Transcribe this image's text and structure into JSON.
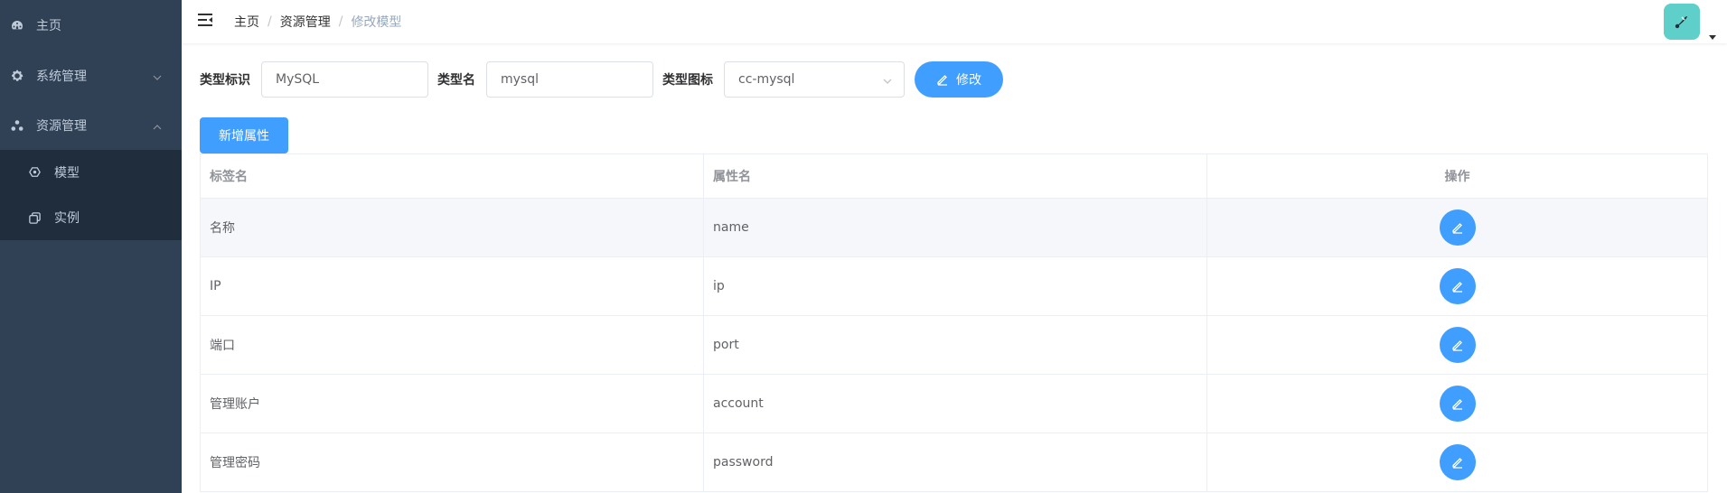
{
  "sidebar": {
    "items": [
      {
        "label": "主页",
        "icon": "dashboard-icon"
      },
      {
        "label": "系统管理",
        "icon": "gear-icon"
      },
      {
        "label": "资源管理",
        "icon": "cluster-icon"
      }
    ],
    "sub_items": [
      {
        "label": "模型",
        "icon": "model-icon"
      },
      {
        "label": "实例",
        "icon": "copy-icon"
      }
    ]
  },
  "breadcrumb": [
    "主页",
    "资源管理",
    "修改模型"
  ],
  "form": {
    "type_id_label": "类型标识",
    "type_id_value": "MySQL",
    "type_name_label": "类型名",
    "type_name_value": "mysql",
    "type_icon_label": "类型图标",
    "type_icon_value": "cc-mysql",
    "modify_label": "修改"
  },
  "add_button_label": "新增属性",
  "table": {
    "headers": [
      "标签名",
      "属性名",
      "操作"
    ],
    "rows": [
      {
        "tag": "名称",
        "attr": "name"
      },
      {
        "tag": "IP",
        "attr": "ip"
      },
      {
        "tag": "端口",
        "attr": "port"
      },
      {
        "tag": "管理账户",
        "attr": "account"
      },
      {
        "tag": "管理密码",
        "attr": "password"
      }
    ]
  },
  "colors": {
    "sidebar_bg": "#304156",
    "submenu_bg": "#1f2d3d",
    "primary": "#409eff",
    "avatar_bg": "#5ecfc9"
  }
}
